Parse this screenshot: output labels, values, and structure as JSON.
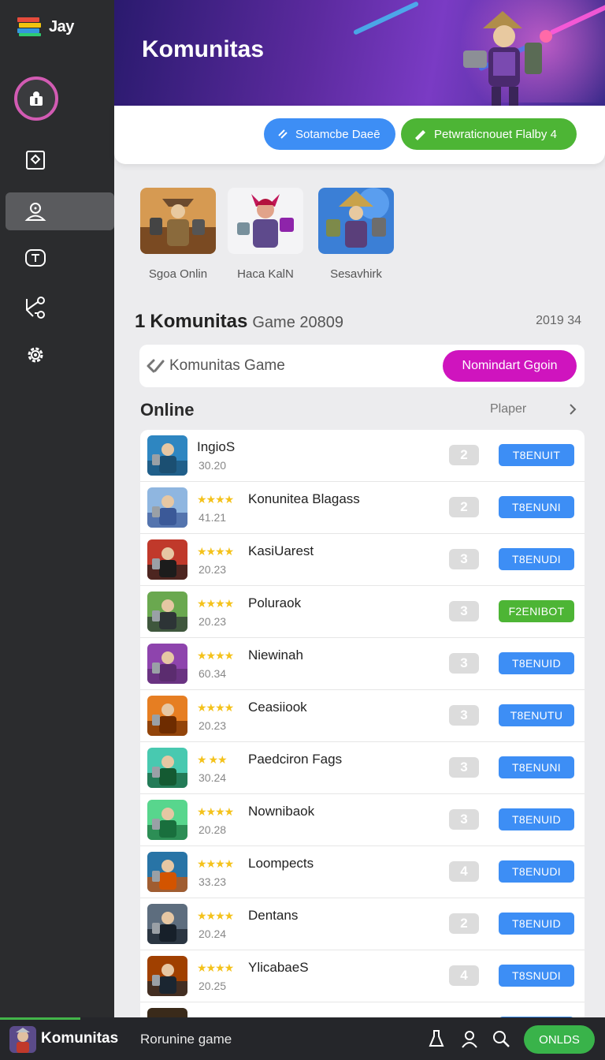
{
  "app": {
    "name": "Jay"
  },
  "hero": {
    "title": "Komunitas"
  },
  "actions": {
    "primary_label": "Sotamcbe Daeē",
    "secondary_label": "Petwraticnouet Flalby 4"
  },
  "featured": [
    {
      "caption": "Sgoa Onlin"
    },
    {
      "caption": "Haca KalN"
    },
    {
      "caption": "Sesavhirk"
    }
  ],
  "section": {
    "marker": "1",
    "title": "Komunitas",
    "subtitle": "Game 20809",
    "right": "2019 34"
  },
  "search": {
    "placeholder": "Komunitas Game",
    "button_label": "Nomindart Ggoin"
  },
  "online": {
    "title": "Online",
    "right_label": "Plaper"
  },
  "list": [
    {
      "name": "IngioS",
      "sub": "30.20",
      "stars": "",
      "count": "2",
      "action": "T8ENUIT",
      "action_color": "#3d8ef5",
      "icon_colors": [
        "#2e86c1",
        "#1b4f72"
      ]
    },
    {
      "name": "Konunitea Blagass",
      "sub": "41.21",
      "stars": "★★★★",
      "count": "2",
      "action": "T8ENUNI",
      "action_color": "#3d8ef5",
      "icon_colors": [
        "#8fb6e0",
        "#3b5998"
      ]
    },
    {
      "name": "KasiUarest",
      "sub": "20.23",
      "stars": "★★★★",
      "count": "3",
      "action": "T8ENUDI",
      "action_color": "#3d8ef5",
      "icon_colors": [
        "#c0392b",
        "#1c1c1c"
      ]
    },
    {
      "name": "Poluraok",
      "sub": "20.23",
      "stars": "★★★★",
      "count": "3",
      "action": "F2ENIBOT",
      "action_color": "#4db535",
      "icon_colors": [
        "#6aa84f",
        "#2d3436"
      ]
    },
    {
      "name": "Niewinah",
      "sub": "60.34",
      "stars": "★★★★",
      "count": "3",
      "action": "T8ENUID",
      "action_color": "#3d8ef5",
      "icon_colors": [
        "#8e44ad",
        "#5b2c6f"
      ]
    },
    {
      "name": "Ceasiiook",
      "sub": "20.23",
      "stars": "★★★★",
      "count": "3",
      "action": "T8ENUTU",
      "action_color": "#3d8ef5",
      "icon_colors": [
        "#e67e22",
        "#6e2c00"
      ]
    },
    {
      "name": "Paedciron Fags",
      "sub": "30.24",
      "stars": "★ ★★",
      "count": "3",
      "action": "T8ENUNI",
      "action_color": "#3d8ef5",
      "icon_colors": [
        "#48c9b0",
        "#145a32"
      ]
    },
    {
      "name": "Nownibaok",
      "sub": "20.28",
      "stars": "★★★★",
      "count": "3",
      "action": "T8ENUID",
      "action_color": "#3d8ef5",
      "icon_colors": [
        "#58d68d",
        "#196f3d"
      ]
    },
    {
      "name": "Loompects",
      "sub": "33.23",
      "stars": "★★★★",
      "count": "4",
      "action": "T8ENUDI",
      "action_color": "#3d8ef5",
      "icon_colors": [
        "#2874a6",
        "#d35400"
      ]
    },
    {
      "name": "Dentans",
      "sub": "20.24",
      "stars": "★★★★",
      "count": "2",
      "action": "T8ENUID",
      "action_color": "#3d8ef5",
      "icon_colors": [
        "#5d6d7e",
        "#17202a"
      ]
    },
    {
      "name": "YlicabaeS",
      "sub": "20.25",
      "stars": "★★★★",
      "count": "4",
      "action": "T8SNUDI",
      "action_color": "#3d8ef5",
      "icon_colors": [
        "#a04000",
        "#1b2631"
      ]
    }
  ],
  "bottom_bar": {
    "title": "Komunitas",
    "subtitle": "Rorunine game",
    "button_label": "ONLDS"
  }
}
